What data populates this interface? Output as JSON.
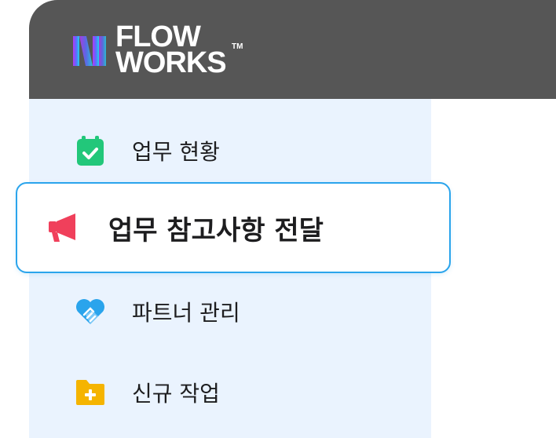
{
  "brand": {
    "line1": "FLOW",
    "line2": "WORKS",
    "tm": "TM"
  },
  "nav": {
    "items": [
      {
        "label": "업무 현황",
        "icon": "calendar-check-icon",
        "color": "#22c77a"
      },
      {
        "label": "업무 참고사항 전달",
        "icon": "megaphone-icon",
        "color": "#f0405b",
        "active": true
      },
      {
        "label": "파트너 관리",
        "icon": "heart-handshake-icon",
        "color": "#2aa4ec"
      },
      {
        "label": "신규 작업",
        "icon": "folder-plus-icon",
        "color": "#f5b400"
      }
    ]
  },
  "colors": {
    "header": "#565656",
    "sidebar": "#eaf3fe",
    "active_border": "#2aa4ec"
  }
}
